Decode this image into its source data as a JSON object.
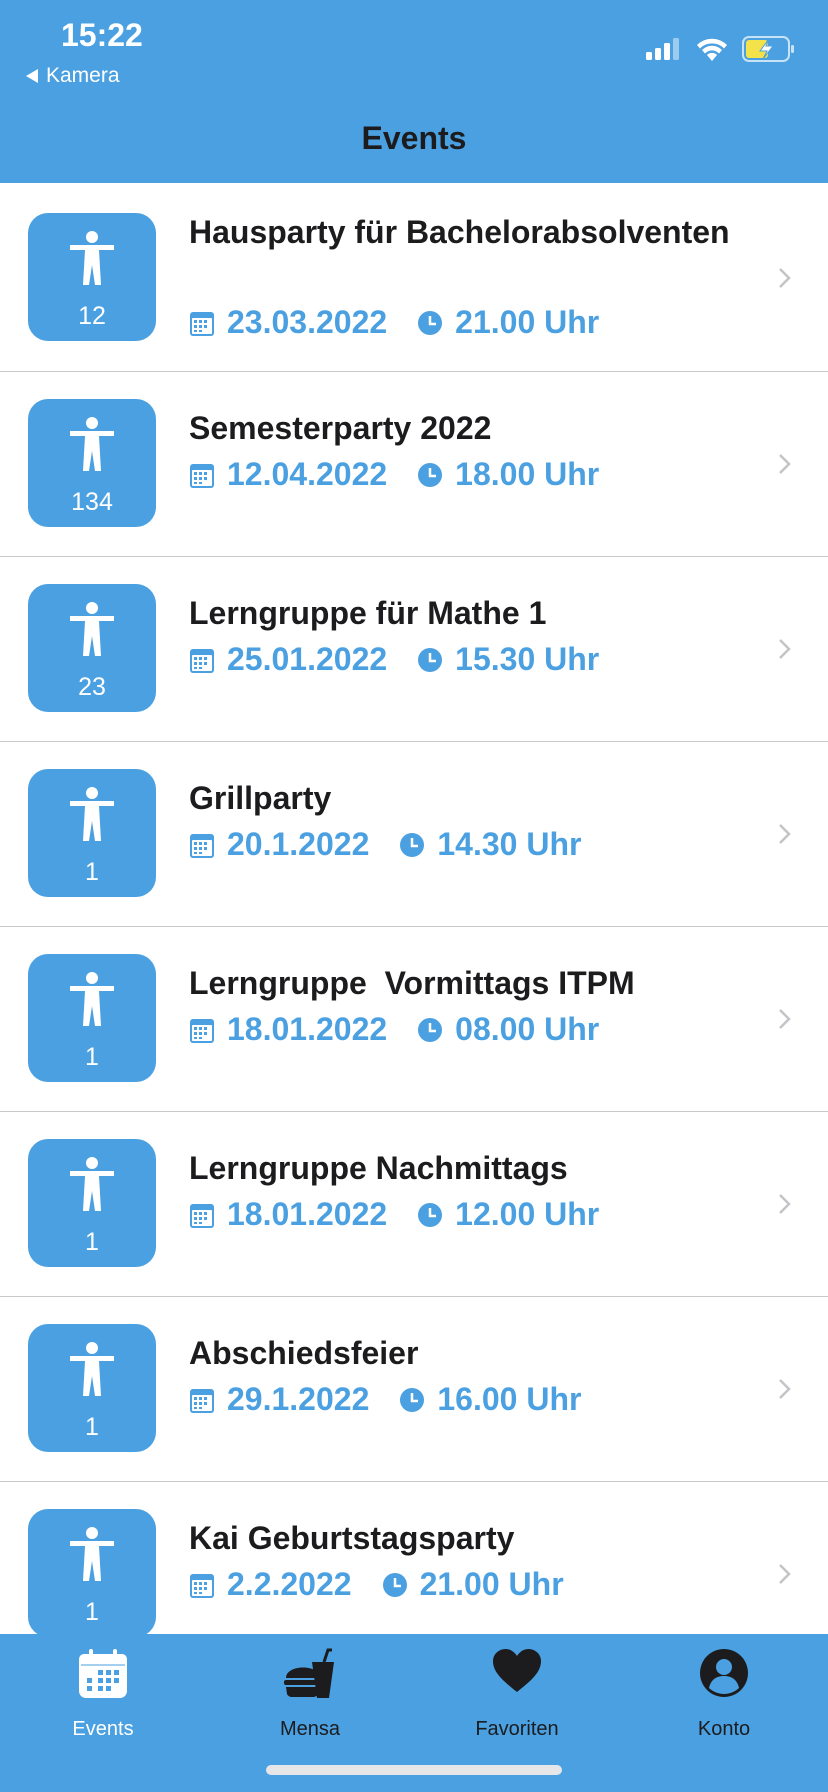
{
  "status_bar": {
    "time": "15:22",
    "back_label": "Kamera",
    "icons": [
      "signal-icon",
      "wifi-icon",
      "battery-charging-icon"
    ]
  },
  "nav": {
    "title": "Events"
  },
  "colors": {
    "accent": "#4aa0e0",
    "text": "#1c1c1e",
    "separator": "#c8c8cc"
  },
  "events": [
    {
      "title": "Hausparty für Bachelorabsolventen",
      "count": "12",
      "date": "23.03.2022",
      "time": "21.00 Uhr"
    },
    {
      "title": "Semesterparty 2022",
      "count": "134",
      "date": "12.04.2022",
      "time": "18.00 Uhr"
    },
    {
      "title": "Lerngruppe für Mathe 1",
      "count": "23",
      "date": "25.01.2022",
      "time": "15.30 Uhr"
    },
    {
      "title": "Grillparty",
      "count": "1",
      "date": "20.1.2022",
      "time": "14.30 Uhr"
    },
    {
      "title": "Lerngruppe  Vormittags ITPM",
      "count": "1",
      "date": "18.01.2022",
      "time": "08.00 Uhr"
    },
    {
      "title": "Lerngruppe Nachmittags",
      "count": "1",
      "date": "18.01.2022",
      "time": "12.00 Uhr"
    },
    {
      "title": "Abschiedsfeier",
      "count": "1",
      "date": "29.1.2022",
      "time": "16.00 Uhr"
    },
    {
      "title": "Kai Geburtstagsparty",
      "count": "1",
      "date": "2.2.2022",
      "time": "21.00 Uhr"
    }
  ],
  "tabs": [
    {
      "label": "Events",
      "icon": "calendar-icon",
      "active": true
    },
    {
      "label": "Mensa",
      "icon": "food-icon",
      "active": false
    },
    {
      "label": "Favoriten",
      "icon": "heart-icon",
      "active": false
    },
    {
      "label": "Konto",
      "icon": "account-icon",
      "active": false
    }
  ]
}
